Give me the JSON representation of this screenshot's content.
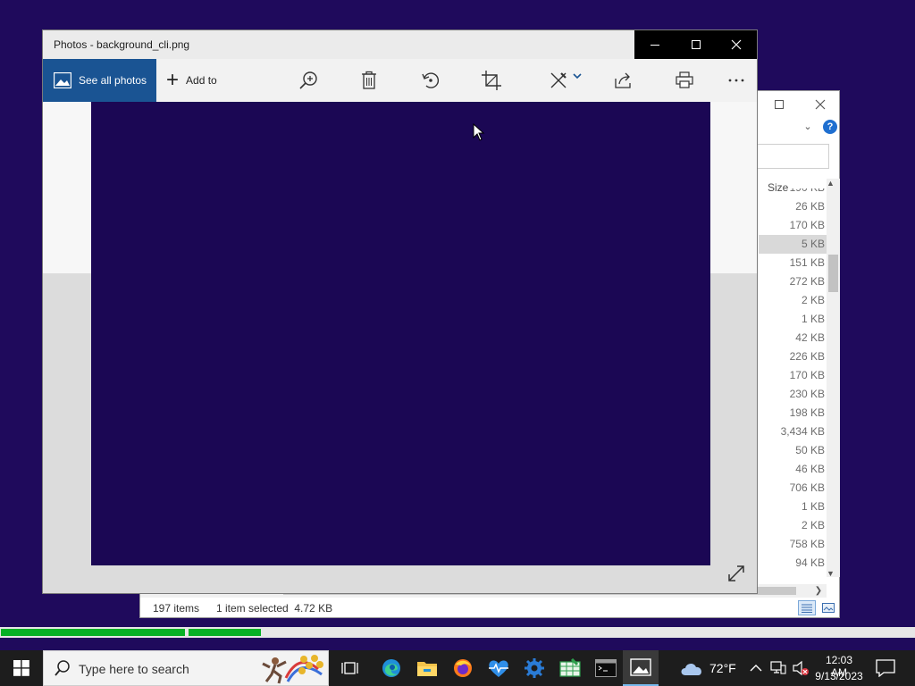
{
  "explorer": {
    "column_header_size": "Size",
    "sizes": [
      "190 KB",
      "26 KB",
      "170 KB",
      "5 KB",
      "151 KB",
      "272 KB",
      "2 KB",
      "1 KB",
      "42 KB",
      "226 KB",
      "170 KB",
      "230 KB",
      "198 KB",
      "3,434 KB",
      "50 KB",
      "46 KB",
      "706 KB",
      "1 KB",
      "2 KB",
      "758 KB",
      "94 KB"
    ],
    "selected_index": 3,
    "status_item_count": "197 items",
    "status_selection": "1 item selected  4.72 KB"
  },
  "photos": {
    "title": "Photos - background_cli.png",
    "see_all_label": "See all photos",
    "add_to_label": "Add to",
    "image_color": "#1b0754"
  },
  "progress": {
    "bar_a_fraction": 1.0,
    "bar_b_fraction": 0.1
  },
  "taskbar": {
    "search_placeholder": "Type here to search",
    "weather_temp": "72°F",
    "clock_time": "12:03 AM",
    "clock_date": "9/13/2023"
  },
  "colors": {
    "desktop": "#1f0a5c",
    "accent_blue": "#1a5493",
    "progress_green": "#06b025"
  }
}
